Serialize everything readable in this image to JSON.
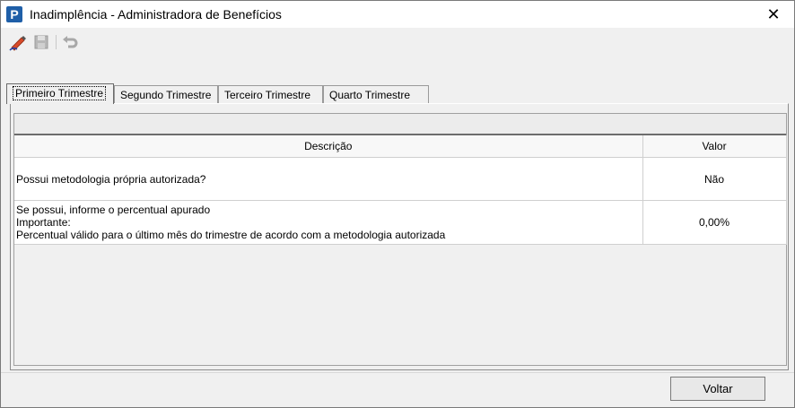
{
  "window": {
    "title": "Inadimplência - Administradora de Benefícios",
    "app_icon_letter": "P",
    "close_glyph": "✕"
  },
  "toolbar": {
    "items": [
      {
        "name": "edit-icon",
        "enabled": true
      },
      {
        "name": "save-icon",
        "enabled": false
      },
      {
        "name": "undo-icon",
        "enabled": false
      }
    ]
  },
  "tabs": [
    {
      "label": "Primeiro Trimestre",
      "active": true
    },
    {
      "label": "Segundo Trimestre",
      "active": false
    },
    {
      "label": "Terceiro Trimestre",
      "active": false
    },
    {
      "label": "Quarto Trimestre",
      "active": false
    }
  ],
  "grid": {
    "columns": [
      "Descrição",
      "Valor"
    ],
    "rows": [
      {
        "description": [
          "Possui metodologia própria autorizada?"
        ],
        "value": "Não"
      },
      {
        "description": [
          "Se possui, informe o percentual apurado",
          "Importante:",
          "Percentual válido para o último mês do trimestre de acordo com a metodologia autorizada"
        ],
        "value": "0,00%"
      }
    ]
  },
  "buttons": {
    "voltar": "Voltar"
  },
  "colors": {
    "icon_blue": "#1f5fa8",
    "edit_red": "#c0392b"
  }
}
